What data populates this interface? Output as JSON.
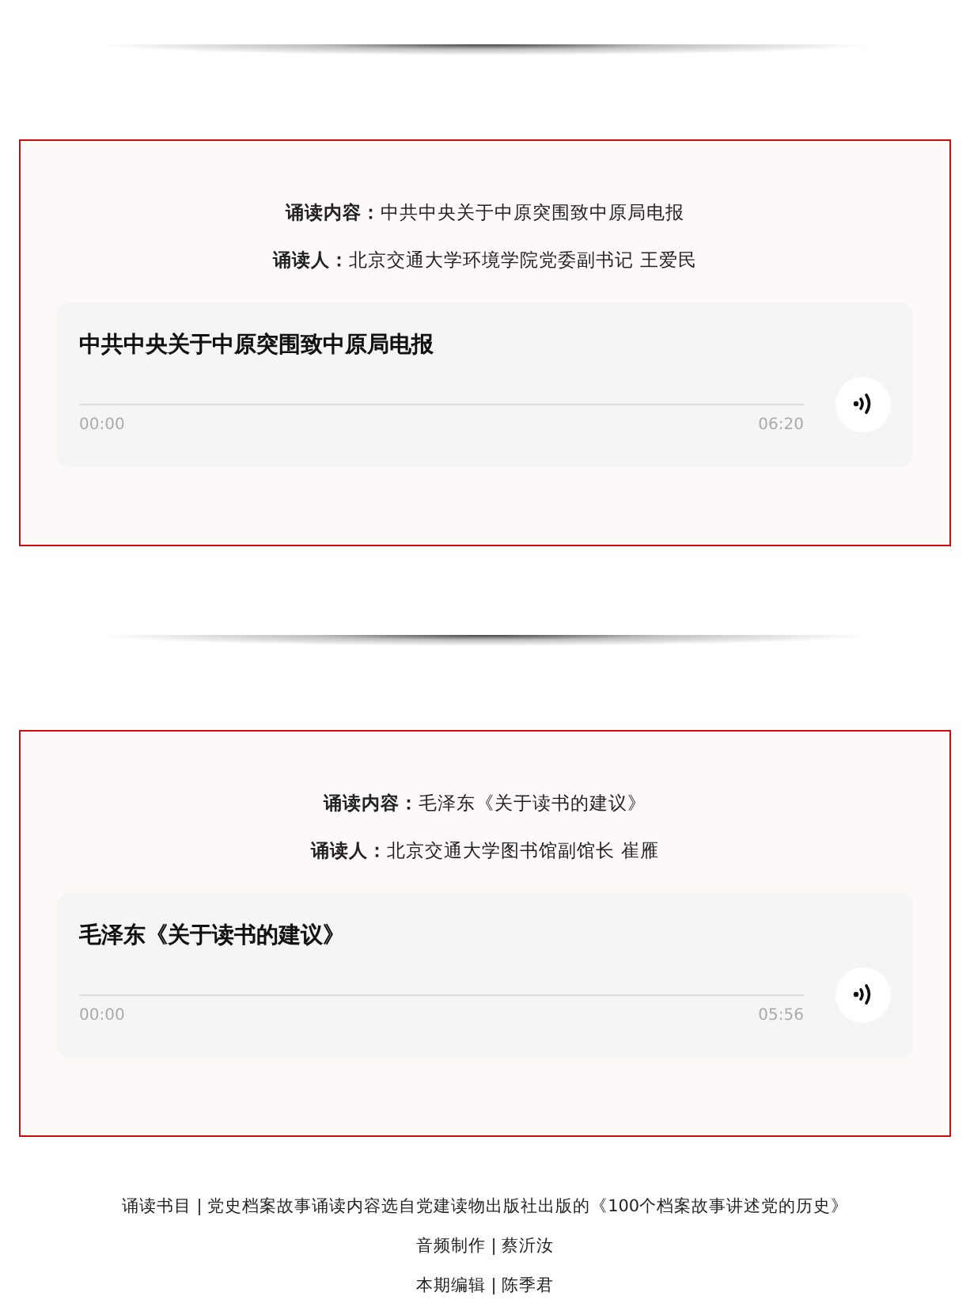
{
  "sections": [
    {
      "content_line": "**诵读内容：**中共中央关于中原突围致中原局电报",
      "reader_line": "**诵读人：**北京交通大学环境学院党委副书记 王爱民",
      "player": {
        "title": "中共中央关于中原突围致中原局电报",
        "level": 0,
        "current_time": "00:00",
        "duration": "06:20"
      }
    },
    {
      "content_line": "**诵读内容：**毛泽东《关于读书的建议》",
      "reader_line": "**诵读人：**北京交通大学图书馆副馆长 崔雁",
      "player": {
        "title": "毛泽东《关于读书的建议》",
        "level": 0,
        "current_time": "00:00",
        "duration": "05:56"
      }
    }
  ],
  "footer": [
    "诵读书目 | 党史档案故事诵读内容选自党建读物出版社出版的《100个档案故事讲述党的历史》",
    "音频制作 | 蔡沂汝",
    "本期编辑 | 陈季君"
  ]
}
